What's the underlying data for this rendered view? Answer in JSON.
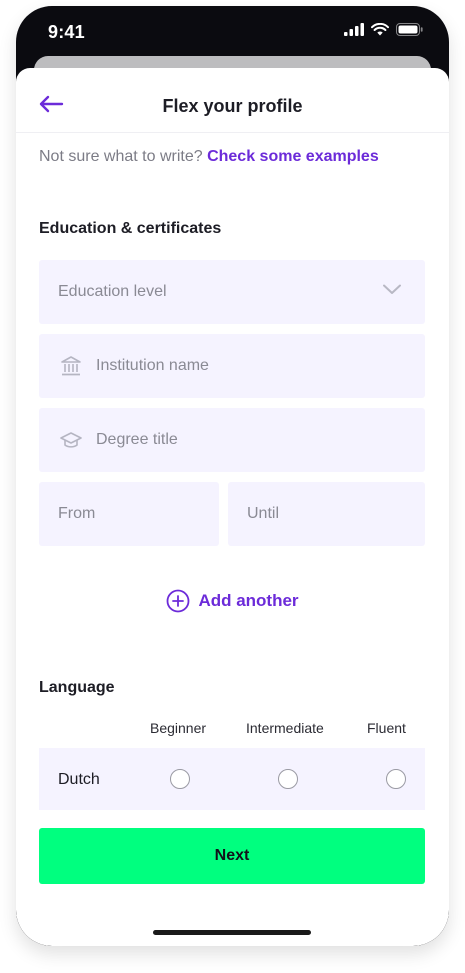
{
  "status_bar": {
    "time": "9:41"
  },
  "header": {
    "title": "Flex your profile"
  },
  "hint": {
    "text": "Not sure what to write?",
    "link": "Check some examples"
  },
  "education": {
    "section_title": "Education & certificates",
    "level_placeholder": "Education level",
    "institution_placeholder": "Institution name",
    "degree_placeholder": "Degree title",
    "from_placeholder": "From",
    "until_placeholder": "Until",
    "add_another_label": "Add another"
  },
  "language": {
    "section_title": "Language",
    "levels": [
      "Beginner",
      "Intermediate",
      "Fluent"
    ],
    "rows": [
      {
        "name": "Dutch"
      }
    ]
  },
  "footer": {
    "next_label": "Next"
  },
  "colors": {
    "accent": "#6c2bd9",
    "field_bg": "#f5f3ff",
    "primary_button": "#00ff7f"
  }
}
